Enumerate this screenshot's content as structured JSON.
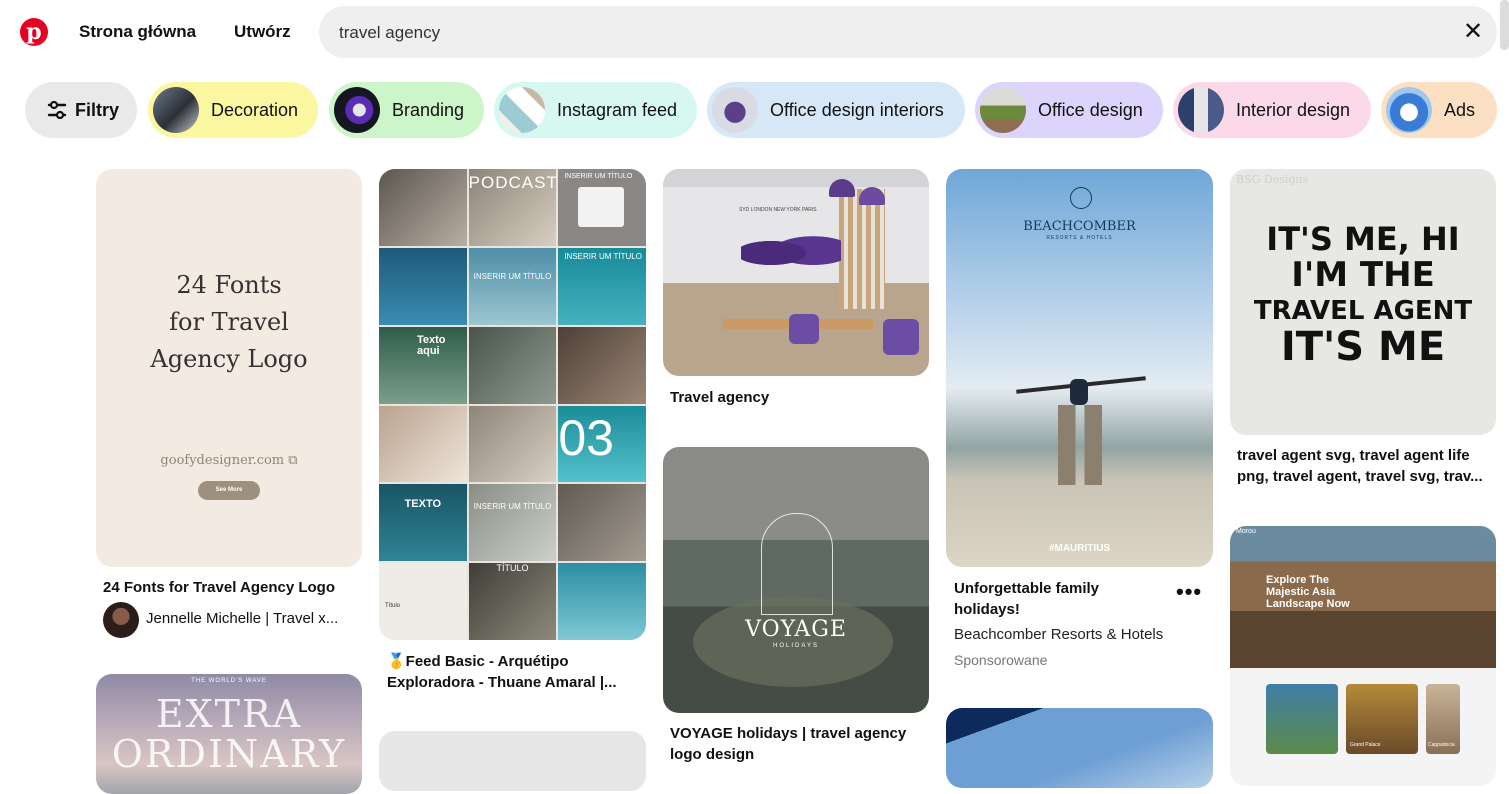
{
  "header": {
    "nav_home": "Strona główna",
    "nav_create": "Utwórz",
    "search_value": "travel agency",
    "clear_icon": "close-icon",
    "logo_icon": "pinterest-logo"
  },
  "chips": [
    {
      "label": "Filtry",
      "icon": "filter-icon",
      "color": "#e9e9e9"
    },
    {
      "label": "Decoration",
      "color": "#fbf7a1"
    },
    {
      "label": "Branding",
      "color": "#ccf5c9"
    },
    {
      "label": "Instagram feed",
      "color": "#d7f7f1"
    },
    {
      "label": "Office design interiors",
      "color": "#d6e7f8"
    },
    {
      "label": "Office design",
      "color": "#dcd4fa"
    },
    {
      "label": "Interior design",
      "color": "#fbd9e9"
    },
    {
      "label": "Ads",
      "color": "#fce0c3"
    }
  ],
  "pins": {
    "fonts": {
      "image_text": {
        "line1": "24 Fonts",
        "line2": "for Travel",
        "line3": "Agency Logo",
        "site": "goofydesigner.com",
        "button": "See More"
      },
      "title": "24 Fonts for Travel Agency Logo",
      "author": "Jennelle Michelle | Travel x..."
    },
    "extra": {
      "image_text": {
        "small": "THE WORLD'S WAVE",
        "big1": "EXTRA",
        "big2": "ORDINARY"
      }
    },
    "feed": {
      "image_text": {
        "podcast": "PODCAST",
        "insert1": "INSERIR UM TÍTULO",
        "insert2": "INSERIR UM TÍTULO",
        "insert3": "INSERIR UM TÍTULO",
        "texto_aqui": "Texto aqui",
        "number": "03",
        "texto": "TEXTO",
        "titulo": "INSERIR UM TÍTULO",
        "titulo2": "TÍTULO",
        "titulo_small": "Título"
      },
      "title": "🥇Feed Basic - Arquétipo Exploradora - Thuane Amaral |..."
    },
    "office": {
      "image_text": {
        "cities": "SYD   LONDON   NEW YORK   PARIS"
      },
      "title": "Travel agency"
    },
    "voyage": {
      "image_text": {
        "brand": "VOYAGE",
        "sub": "HOLIDAYS"
      },
      "title": "VOYAGE holidays | travel agency logo design"
    },
    "beachcomber": {
      "image_text": {
        "brand": "BEACHCOMBER",
        "sub": "RESORTS & HOTELS",
        "tag": "#MAURITIUS"
      },
      "title": "Unforgettable family holidays!",
      "advertiser": "Beachcomber Resorts & Hotels",
      "sponsored": "Sponsorowane",
      "more_icon": "more-options-icon"
    },
    "svg": {
      "image_text": {
        "l1": "IT'S ME, HI",
        "l2": "I'M THE",
        "l3": "TRAVEL AGENT",
        "l4": "IT'S ME",
        "watermark": "BSG Designs"
      },
      "title": "travel agent svg, travel agent life png, travel agent, travel svg, trav..."
    },
    "asia": {
      "image_text": {
        "brand": "Morou",
        "h1": "Explore The",
        "h2": "Majestic Asia",
        "h3": "Landscape Now",
        "card1": "Grand Palace",
        "card2": "Cappadocia"
      }
    }
  },
  "colors": {
    "brand": "#e60023",
    "search_bg": "#efefef"
  }
}
